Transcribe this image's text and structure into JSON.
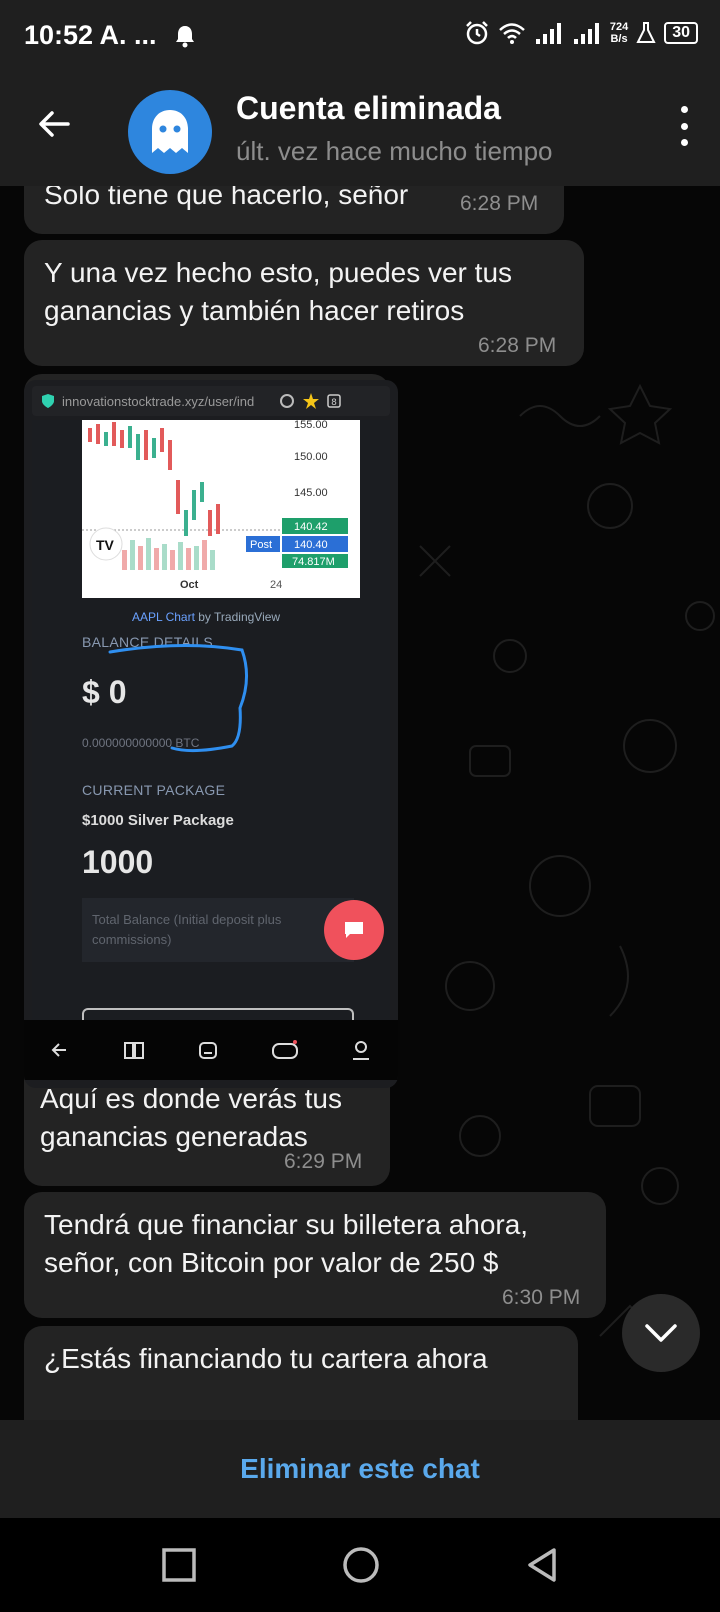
{
  "status_bar": {
    "time": "10:52 A. ...",
    "net_speed_value": "724",
    "net_speed_unit": "B/s",
    "battery": "30"
  },
  "header": {
    "title": "Cuenta eliminada",
    "subtitle": "últ. vez hace mucho tiempo"
  },
  "messages": [
    {
      "text": "Solo tiene que hacerlo, señor",
      "time": "6:28 PM"
    },
    {
      "text": "Y una vez hecho esto, puedes ver tus ganancias y también hacer retiros",
      "time": "6:28 PM"
    },
    {
      "text": "Aquí es donde verás tus ganancias generadas",
      "time": "6:29 PM"
    },
    {
      "text": "Tendrá que financiar su billetera ahora, señor, con Bitcoin por valor de 250 $",
      "time": "6:30 PM"
    },
    {
      "text": "¿Estás financiando tu cartera ahora"
    }
  ],
  "screenshot": {
    "url": "innovationstocktrade.xyz/user/ind",
    "chart": {
      "price_labels": [
        "155.00",
        "150.00",
        "145.00"
      ],
      "tag_price1": "140.42",
      "tag_post_label": "Post",
      "tag_price2": "140.40",
      "tag_volume": "74.817M",
      "x_label_1": "Oct",
      "x_label_2": "24"
    },
    "chart_caption_link": "AAPL Chart",
    "chart_caption_rest": " by TradingView",
    "balance_details_label": "BALANCE DETAILS",
    "balance_value": "$ 0",
    "btc_line": "0.000000000000 BTC",
    "current_package_label": "CURRENT PACKAGE",
    "package_name": "$1000 Silver Package",
    "package_value": "1000",
    "total_balance_text": "Total Balance (Initial deposit plus commissions)"
  },
  "bottom_bar": {
    "delete_label": "Eliminar este chat"
  },
  "colors": {
    "bubble": "#232323",
    "accent_link": "#5aa9ec",
    "avatar": "#2e86de",
    "fab": "#f0515c",
    "price_tag_green": "#1e9f6b",
    "price_tag_blue": "#2b6fd6"
  }
}
